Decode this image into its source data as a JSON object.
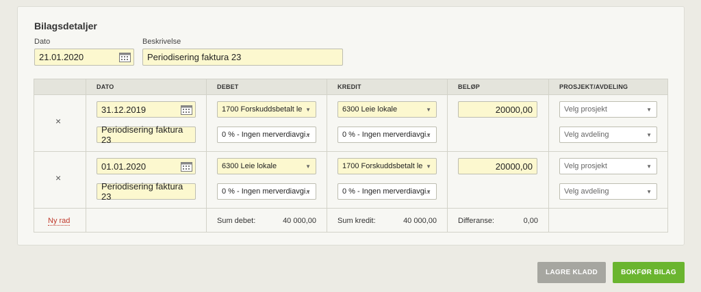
{
  "section_title": "Bilagsdetaljer",
  "header": {
    "date_label": "Dato",
    "date_value": "21.01.2020",
    "desc_label": "Beskrivelse",
    "desc_value": "Periodisering faktura 23"
  },
  "table": {
    "columns": [
      "",
      "DATO",
      "DEBET",
      "KREDIT",
      "BELØP",
      "PROSJEKT/AVDELING"
    ],
    "rows": [
      {
        "remove": "×",
        "date": "31.12.2019",
        "description": "Periodisering faktura 23",
        "debit_account": "1700 Forskuddsbetalt le",
        "debit_vat": "0 % - Ingen merverdiavgi..",
        "credit_account": "6300 Leie lokale",
        "credit_vat": "0 % - Ingen merverdiavgi..",
        "amount": "20000,00",
        "project_placeholder": "Velg prosjekt",
        "department_placeholder": "Velg avdeling"
      },
      {
        "remove": "×",
        "date": "01.01.2020",
        "description": "Periodisering faktura 23",
        "debit_account": "6300 Leie lokale",
        "debit_vat": "0 % - Ingen merverdiavgi..",
        "credit_account": "1700 Forskuddsbetalt le",
        "credit_vat": "0 % - Ingen merverdiavgi..",
        "amount": "20000,00",
        "project_placeholder": "Velg prosjekt",
        "department_placeholder": "Velg avdeling"
      }
    ],
    "footer": {
      "new_row": "Ny rad",
      "sum_debit_label": "Sum debet:",
      "sum_debit_value": "40 000,00",
      "sum_credit_label": "Sum kredit:",
      "sum_credit_value": "40 000,00",
      "difference_label": "Differanse:",
      "difference_value": "0,00"
    }
  },
  "buttons": {
    "save_draft": "LAGRE KLADD",
    "post": "BOKFØR BILAG"
  },
  "colors": {
    "input_highlight": "#fcf8cf",
    "post_button": "#6ab52f",
    "draft_button": "#a6a6a0",
    "new_row_link": "#c0392b"
  }
}
